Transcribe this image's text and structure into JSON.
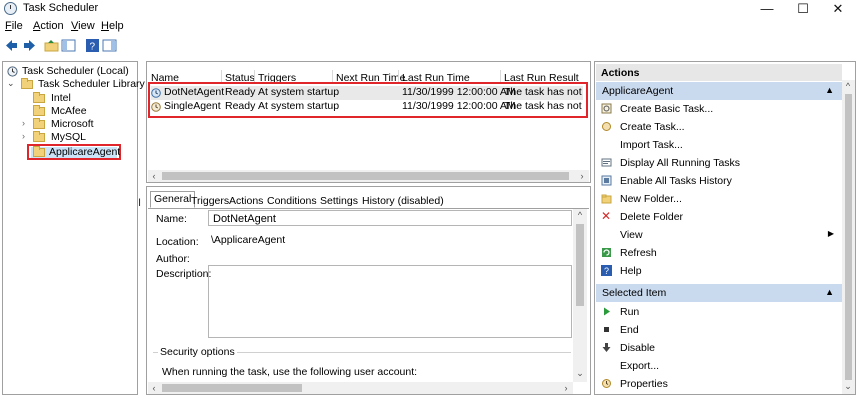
{
  "window": {
    "title": "Task Scheduler",
    "minimize": "—",
    "maximize": "☐",
    "close": "✕"
  },
  "menu": [
    {
      "label": "File",
      "accel": "F"
    },
    {
      "label": "Action",
      "accel": "A"
    },
    {
      "label": "View",
      "accel": "V"
    },
    {
      "label": "Help",
      "accel": "H"
    }
  ],
  "tree": {
    "root": "Task Scheduler (Local)",
    "library": "Task Scheduler Library",
    "folders": [
      "Intel",
      "McAfee",
      "Microsoft",
      "MySQL",
      "ApplicareAgent"
    ],
    "selected": "ApplicareAgent"
  },
  "task_list": {
    "columns": [
      "Name",
      "Status",
      "Triggers",
      "Next Run Time",
      "Last Run Time",
      "Last Run Result"
    ],
    "rows": [
      {
        "name": "DotNetAgent",
        "status": "Ready",
        "triggers": "At system startup",
        "next_run": "",
        "last_run": "11/30/1999 12:00:00 AM",
        "result": "The task has not yet r"
      },
      {
        "name": "SingleAgent",
        "status": "Ready",
        "triggers": "At system startup",
        "next_run": "",
        "last_run": "11/30/1999 12:00:00 AM",
        "result": "The task has not yet r"
      }
    ]
  },
  "detail": {
    "tabs": [
      "General",
      "Triggers",
      "Actions",
      "Conditions",
      "Settings",
      "History (disabled)"
    ],
    "active_tab": "General",
    "name_label": "Name:",
    "name_value": "DotNetAgent",
    "location_label": "Location:",
    "location_value": "\\ApplicareAgent",
    "author_label": "Author:",
    "description_label": "Description:",
    "security_label": "Security options",
    "security_text": "When running the task, use the following user account:"
  },
  "actions": {
    "header": "Actions",
    "group1": "ApplicareAgent",
    "items1": [
      {
        "label": "Create Basic Task...",
        "icon": "create-basic-task-icon"
      },
      {
        "label": "Create Task...",
        "icon": "create-task-icon"
      },
      {
        "label": "Import Task...",
        "icon": ""
      },
      {
        "label": "Display All Running Tasks",
        "icon": "running-tasks-icon"
      },
      {
        "label": "Enable All Tasks History",
        "icon": "tasks-history-icon"
      },
      {
        "label": "New Folder...",
        "icon": "new-folder-icon"
      },
      {
        "label": "Delete Folder",
        "icon": "delete-icon"
      },
      {
        "label": "View",
        "icon": "",
        "submenu": "▶"
      },
      {
        "label": "Refresh",
        "icon": "refresh-icon"
      },
      {
        "label": "Help",
        "icon": "help-icon"
      }
    ],
    "group2": "Selected Item",
    "items2": [
      {
        "label": "Run",
        "icon": "run-icon"
      },
      {
        "label": "End",
        "icon": "end-icon"
      },
      {
        "label": "Disable",
        "icon": "disable-icon"
      },
      {
        "label": "Export...",
        "icon": ""
      },
      {
        "label": "Properties",
        "icon": "properties-icon"
      }
    ],
    "collapse": "▲"
  },
  "colors": {
    "highlight_box": "#e0262b",
    "selected_bg": "#cce4f7",
    "group_bg": "#c9d9ee"
  }
}
